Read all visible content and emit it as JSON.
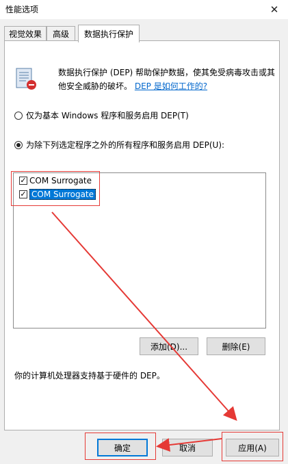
{
  "window": {
    "title": "性能选项",
    "close_glyph": "✕"
  },
  "tabs": [
    {
      "label": "视觉效果"
    },
    {
      "label": "高级"
    },
    {
      "label": "数据执行保护"
    }
  ],
  "intro": {
    "text": "数据执行保护 (DEP) 帮助保护数据，使其免受病毒攻击或其他安全威胁的破坏。",
    "link": "DEP 是如何工作的?"
  },
  "options": [
    {
      "label": "仅为基本 Windows 程序和服务启用 DEP(T)",
      "selected": false
    },
    {
      "label": "为除下列选定程序之外的所有程序和服务启用 DEP(U):",
      "selected": true
    }
  ],
  "program_list": [
    {
      "name": "COM Surrogate",
      "checked": true
    },
    {
      "name": "COM Surrogate",
      "checked": true
    }
  ],
  "buttons": {
    "add": "添加(D)...",
    "remove": "删除(E)",
    "ok": "确定",
    "cancel": "取消",
    "apply": "应用(A)"
  },
  "hardware_note": "你的计算机处理器支持基于硬件的 DEP。",
  "colors": {
    "accent": "#0078d7",
    "annotation": "#e53935",
    "link": "#0066cc"
  }
}
